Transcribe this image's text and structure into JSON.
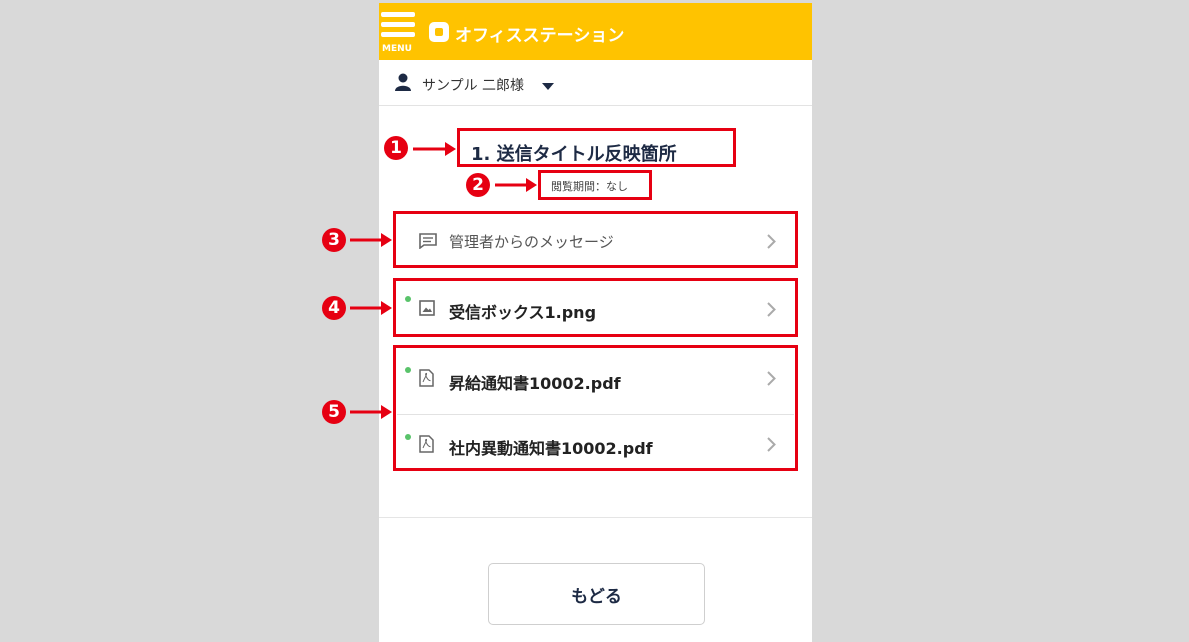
{
  "header": {
    "menu_label": "MENU",
    "logo_text": "オフィスステーション",
    "background_color": "#ffc300"
  },
  "user": {
    "name": "サンプル 二郎様"
  },
  "document": {
    "title": "1. 送信タイトル反映箇所",
    "period": "閲覧期間：なし"
  },
  "items": [
    {
      "label": "管理者からのメッセージ",
      "icon": "message-icon",
      "unread": false
    },
    {
      "label": "受信ボックス1.png",
      "icon": "image-file-icon",
      "unread": true
    },
    {
      "label": "昇給通知書10002.pdf",
      "icon": "pdf-file-icon",
      "unread": true
    },
    {
      "label": "社内異動通知書10002.pdf",
      "icon": "pdf-file-icon",
      "unread": true
    }
  ],
  "back_button": {
    "label": "もどる"
  },
  "annotations": [
    "1",
    "2",
    "3",
    "4",
    "5"
  ],
  "colors": {
    "annotation": "#e60012",
    "unread_dot": "#59c36a",
    "title": "#1d2a44"
  }
}
